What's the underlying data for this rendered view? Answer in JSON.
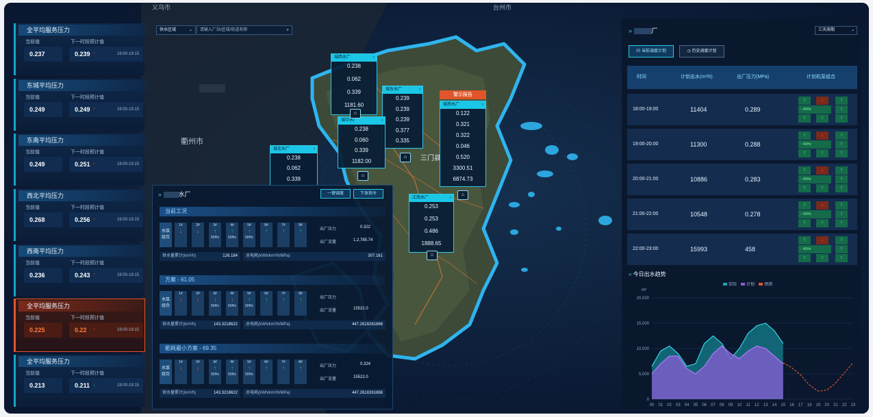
{
  "map": {
    "city_labels": [
      "义乌市",
      "台州市",
      "衢州市"
    ],
    "district_label": "三门县",
    "filter_select": "供水区域",
    "search_placeholder": "请输入厂站/区域/街道名称"
  },
  "left_cards": [
    {
      "title": "全平均服务压力",
      "current_label": "当前值",
      "next_label": "下一时段预计值",
      "current": "0.237",
      "next": "0.239",
      "trend": "up",
      "time": "19:00-19:15"
    },
    {
      "title": "东城平均压力",
      "current_label": "当前值",
      "next_label": "下一时段预计值",
      "current": "0.249",
      "next": "0.249",
      "trend": "up",
      "time": "19:00-19:15"
    },
    {
      "title": "东南平均压力",
      "current_label": "当前值",
      "next_label": "下一时段预计值",
      "current": "0.249",
      "next": "0.251",
      "trend": "up",
      "time": "19:00-19:15"
    },
    {
      "title": "西北平均压力",
      "current_label": "当前值",
      "next_label": "下一时段预计值",
      "current": "0.268",
      "next": "0.256",
      "trend": "up",
      "time": "19:00-19:15"
    },
    {
      "title": "西南平均压力",
      "current_label": "当前值",
      "next_label": "下一时段预计值",
      "current": "0.236",
      "next": "0.243",
      "trend": "up",
      "time": "19:00-19:15"
    },
    {
      "title": "全平均服务压力",
      "current_label": "当前值",
      "next_label": "下一时段预计值",
      "current": "0.225",
      "next": "0.22",
      "trend": "up",
      "time": "19:00-19:15",
      "warning": true
    },
    {
      "title": "全平均服务压力",
      "current_label": "当前值",
      "next_label": "下一时段预计值",
      "current": "0.213",
      "next": "0.211",
      "trend": "down",
      "time": "19:00-19:15"
    }
  ],
  "popups": [
    {
      "title": "城西水厂",
      "values": [
        "0.238",
        "0.062",
        "0.339",
        "1181.60"
      ]
    },
    {
      "title": "城东水厂",
      "values": [
        "0.239",
        "0.239",
        "0.239",
        "0.377",
        "0.335"
      ]
    },
    {
      "title": "城中水厂",
      "values": [
        "0.238",
        "0.060",
        "0.339",
        "1182.00"
      ]
    },
    {
      "title": "城北水厂",
      "values": [
        "0.238",
        "0.062",
        "0.339"
      ]
    },
    {
      "title": "城南水厂",
      "values": [
        "0.122",
        "0.321",
        "0.322",
        "0.046",
        "0.520",
        "3300.51",
        "6874.73"
      ],
      "badge": "警示报告"
    },
    {
      "title": "江南水厂",
      "values": [
        "0.253",
        "0.253",
        "0.486",
        "1888.65"
      ]
    }
  ],
  "plant_panel": {
    "title": "水厂",
    "btn_schedule": "一键调度",
    "btn_issue": "下发指令",
    "sections": [
      {
        "header": "当前工况",
        "side_label": "水泵 组合",
        "pumps": [
          {
            "label": "1#",
            "dir": "dn",
            "hz": ""
          },
          {
            "label": "2#",
            "dir": "dn",
            "hz": ""
          },
          {
            "label": "3#",
            "dir": "up",
            "hz": "50Hz"
          },
          {
            "label": "4#",
            "dir": "up",
            "hz": "50Hz"
          },
          {
            "label": "5#",
            "dir": "up",
            "hz": "50Hz"
          },
          {
            "label": "6#",
            "dir": "up",
            "hz": ""
          },
          {
            "label": "7#",
            "dir": "up",
            "hz": ""
          },
          {
            "label": "8#",
            "dir": "up",
            "hz": ""
          }
        ],
        "k1": "出厂压力",
        "v1": "0.322",
        "k2": "出厂流量",
        "v2": "1,2,785.74",
        "f1_label": "供水量累计(km³/h)",
        "f1_value": "126.184",
        "f2_label": "总电耗(kWh/km³/h/MPa)",
        "f2_value": "307.161"
      },
      {
        "header": "方案 - 61.05",
        "side_label": "水泵 组合",
        "pumps": [
          {
            "label": "1#",
            "dir": "dn",
            "hz": ""
          },
          {
            "label": "2#",
            "dir": "dn",
            "hz": ""
          },
          {
            "label": "3#",
            "dir": "dn",
            "hz": "50Hz"
          },
          {
            "label": "4#",
            "dir": "dn",
            "hz": "50Hz"
          },
          {
            "label": "5#",
            "dir": "up",
            "hz": "50Hz"
          },
          {
            "label": "6#",
            "dir": "up",
            "hz": ""
          },
          {
            "label": "7#",
            "dir": "up",
            "hz": ""
          },
          {
            "label": "8#",
            "dir": "up",
            "hz": ""
          }
        ],
        "k1": "出厂压力",
        "v1": "",
        "k2": "出厂流量",
        "v2": "15522.0",
        "f1_label": "供水量累计(km³/h)",
        "f1_value": "143.3218622",
        "f2_label": "总电耗(kWh/km³/h/MPa)",
        "f2_value": "447.2618261868"
      },
      {
        "header": "能耗最小方案 - 69.35",
        "side_label": "水泵 组合",
        "pumps": [
          {
            "label": "1#",
            "dir": "dn",
            "hz": ""
          },
          {
            "label": "2#",
            "dir": "dn",
            "hz": ""
          },
          {
            "label": "3#",
            "dir": "up",
            "hz": "50Hz"
          },
          {
            "label": "4#",
            "dir": "up",
            "hz": "50Hz"
          },
          {
            "label": "5#",
            "dir": "up",
            "hz": "50Hz"
          },
          {
            "label": "6#",
            "dir": "up",
            "hz": ""
          },
          {
            "label": "7#",
            "dir": "up",
            "hz": ""
          },
          {
            "label": "8#",
            "dir": "up",
            "hz": ""
          }
        ],
        "k1": "出厂压力",
        "v1": "0.324",
        "k2": "出厂流量",
        "v2": "15522.0",
        "f1_label": "供水量累计(km³/h)",
        "f1_value": "143.3218622",
        "f2_label": "总电耗(kWh/km³/h/MPa)",
        "f2_value": "447.2618261868"
      }
    ]
  },
  "right_panel": {
    "title": "厂",
    "period_select": "三天周期",
    "btn_current": "当前调度计划",
    "btn_history": "历史调度计划",
    "table_headers": [
      "时间",
      "计划出水(m³/h)",
      "出厂压力(MPa)",
      "计划机泵组合"
    ],
    "rows": [
      {
        "time": "18:00-19:00",
        "flow": "11404",
        "pressure": "0.289"
      },
      {
        "time": "19:00-20:00",
        "flow": "11300",
        "pressure": "0.288"
      },
      {
        "time": "20:00-21:00",
        "flow": "10886",
        "pressure": "0.283"
      },
      {
        "time": "21:00-22:00",
        "flow": "10548",
        "pressure": "0.278"
      },
      {
        "time": "22:00-23:00",
        "flow": "15993",
        "pressure": "458"
      }
    ],
    "pump_tag": "40Hz",
    "chart_title": "今日出水趋势"
  },
  "chart_data": {
    "type": "area",
    "title": "今日出水趋势",
    "ylabel": "m³",
    "ylim": [
      0,
      20000
    ],
    "yticks": [
      "0",
      "5,000",
      "10,000",
      "15,000",
      "20,000"
    ],
    "x": [
      "00",
      "01",
      "02",
      "03",
      "04",
      "05",
      "06",
      "07",
      "08",
      "09",
      "10",
      "11",
      "12",
      "13",
      "14",
      "15",
      "16",
      "17",
      "18",
      "19",
      "20",
      "21",
      "22",
      "23"
    ],
    "series": [
      {
        "name": "实际",
        "color": "#1aa6b0",
        "values": [
          6500,
          9500,
          10500,
          9000,
          6500,
          7000,
          11000,
          12500,
          11000,
          8000,
          10000,
          13000,
          14500,
          15000,
          13500,
          11000,
          null,
          null,
          null,
          null,
          null,
          null,
          null,
          null
        ]
      },
      {
        "name": "计划",
        "color": "#8a5cd6",
        "values": [
          5000,
          7000,
          8500,
          8500,
          6000,
          5000,
          6500,
          9000,
          10500,
          9000,
          8000,
          9500,
          10500,
          10000,
          8500,
          7000,
          null,
          null,
          null,
          null,
          null,
          null,
          null,
          null
        ]
      },
      {
        "name": "预测",
        "color": "#e0562a",
        "values": [
          null,
          null,
          null,
          null,
          null,
          null,
          null,
          null,
          null,
          null,
          null,
          null,
          null,
          null,
          null,
          7200,
          6200,
          4800,
          2800,
          1600,
          1800,
          3200,
          5200,
          7200
        ]
      }
    ],
    "legend": [
      "实际",
      "计划",
      "预测"
    ],
    "legend_position": "top"
  }
}
